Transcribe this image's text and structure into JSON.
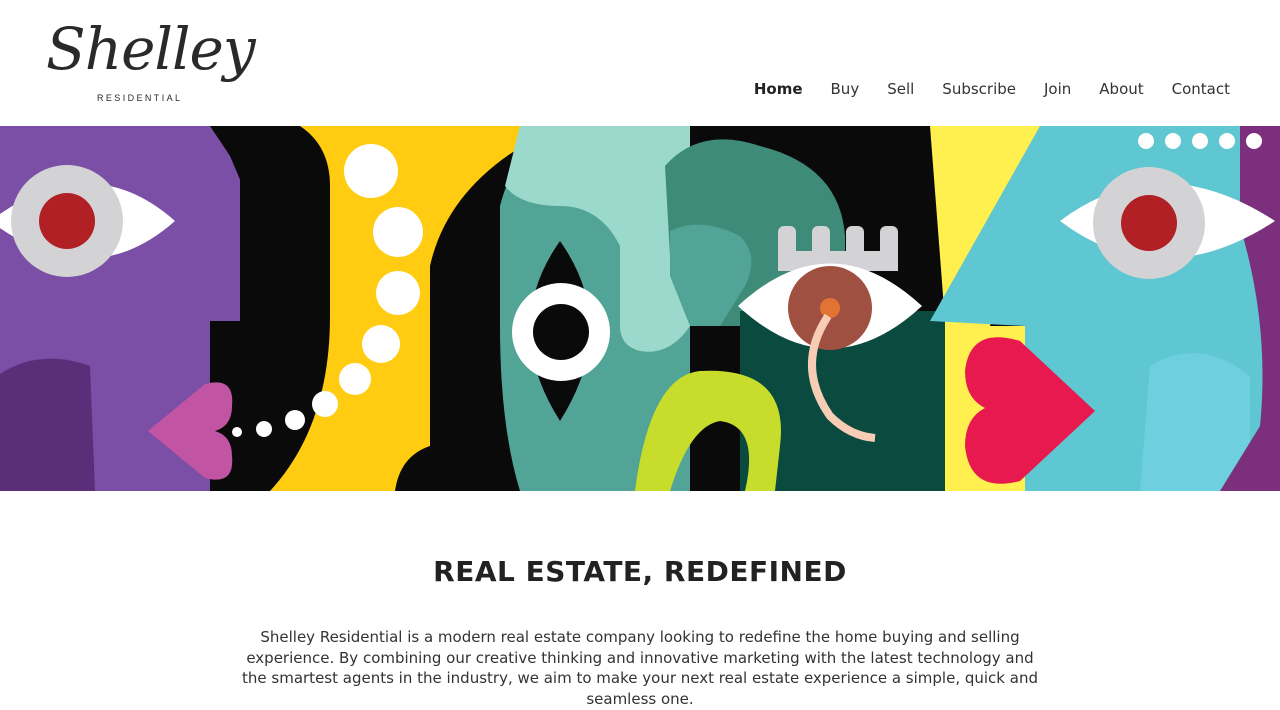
{
  "brand": {
    "script": "Shelley",
    "sub": "RESIDENTIAL"
  },
  "nav": [
    {
      "label": "Home",
      "active": true
    },
    {
      "label": "Buy"
    },
    {
      "label": "Sell"
    },
    {
      "label": "Subscribe"
    },
    {
      "label": "Join"
    },
    {
      "label": "About"
    },
    {
      "label": "Contact"
    }
  ],
  "hero": {
    "image": "abstract-faces-illustration"
  },
  "intro": {
    "heading": "REAL ESTATE, REDEFINED",
    "body": "Shelley Residential is a modern real estate company looking to redefine the home buying and selling experience. By combining our creative thinking and innovative marketing with the latest technology and the smartest agents in the industry, we aim to make your next real estate experience a simple, quick and seamless one."
  },
  "colors": {
    "text": "#222222",
    "purple": "#7b4fa6",
    "yellow": "#ffcc11",
    "teal": "#52a596",
    "cyan": "#5ec7d1",
    "pink": "#e8194f"
  }
}
